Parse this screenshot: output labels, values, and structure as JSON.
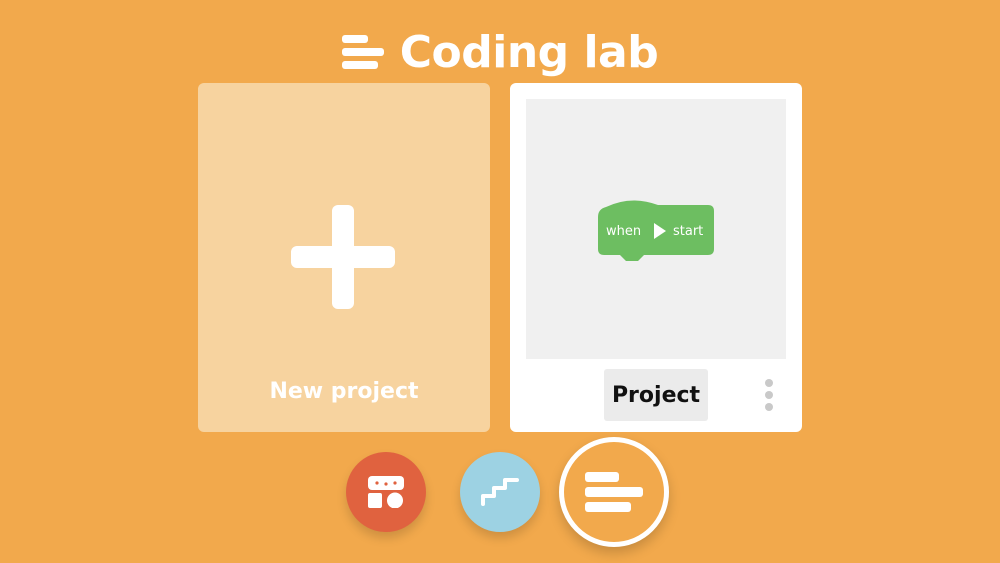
{
  "header": {
    "title": "Coding lab",
    "icon": "coding-lab-icon"
  },
  "new_project": {
    "label": "New project",
    "icon": "plus-icon"
  },
  "project": {
    "name": "Project",
    "block": {
      "when_text": "when",
      "start_text": "start",
      "icon": "play-icon",
      "color": "#6DBE61"
    },
    "menu_icon": "kebab-menu-icon"
  },
  "bottom_nav": {
    "items": [
      {
        "icon": "blocks-shapes-icon",
        "color": "#E0623F"
      },
      {
        "icon": "stairs-icon",
        "color": "#9DD2E3"
      },
      {
        "icon": "coding-lab-icon",
        "color": "#F2A94C",
        "selected": true
      }
    ]
  },
  "colors": {
    "background": "#F2A94C",
    "accent_white": "#FFFFFF"
  }
}
